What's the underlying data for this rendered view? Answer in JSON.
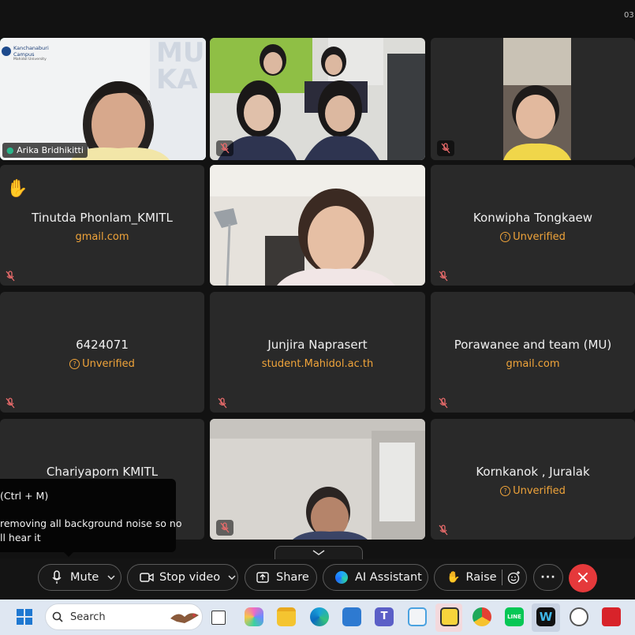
{
  "clock_fragment": "03",
  "tiles": {
    "arika": {
      "name": "Arika Bridhikitti",
      "logo_line1": "Kanchanaburi",
      "logo_line2": "Campus",
      "logo_line3": "Mahidol University",
      "banner": "MU\nKA"
    },
    "tinutda": {
      "name": "Tinutda Phonlam_KMITL",
      "sub": "gmail.com"
    },
    "konwipha": {
      "name": "Konwipha Tongkaew",
      "sub": "Unverified"
    },
    "id6424071": {
      "name": "6424071",
      "sub": "Unverified"
    },
    "junjira": {
      "name": "Junjira Naprasert",
      "sub": "student.Mahidol.ac.th"
    },
    "porawanee": {
      "name": "Porawanee and team (MU)",
      "sub": "gmail.com"
    },
    "chariyaporn": {
      "name": "Chariyaporn KMITL"
    },
    "kornkanok": {
      "name": "Kornkanok , Juralak",
      "sub": "Unverified"
    }
  },
  "tooltip": {
    "line1": "(Ctrl + M)",
    "line2": "removing all background noise so no",
    "line3": "ll hear it"
  },
  "toolbar": {
    "mute": "Mute",
    "stop_video": "Stop video",
    "share": "Share",
    "ai_assistant": "AI Assistant",
    "raise": "Raise",
    "more": "···",
    "leave": "×"
  },
  "taskbar": {
    "search_label": "Search"
  },
  "colors": {
    "accent_green": "#2bb58a",
    "unverified": "#f0a43a",
    "leave_red": "#e5393b"
  }
}
